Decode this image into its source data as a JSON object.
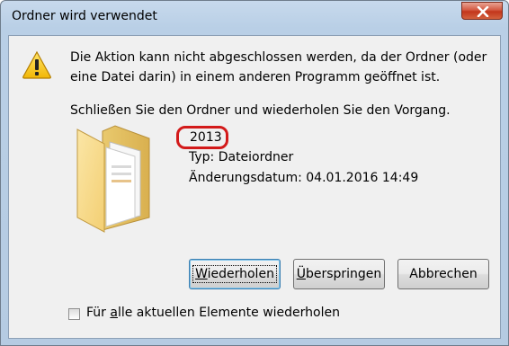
{
  "window": {
    "title": "Ordner wird verwendet",
    "close_icon": "close-icon"
  },
  "message": {
    "line1": "Die Aktion kann nicht abgeschlossen werden, da der Ordner (oder eine Datei darin) in einem anderen Programm geöffnet ist.",
    "line2": "Schließen Sie den Ordner und wiederholen Sie den Vorgang."
  },
  "item": {
    "name": "2013",
    "type": "Typ: Dateiordner",
    "modified": "Änderungsdatum: 04.01.2016 14:49",
    "icon": "folder-icon",
    "highlight_color": "#d31a1a"
  },
  "buttons": {
    "retry_pre": "",
    "retry_key": "W",
    "retry_post": "iederholen",
    "skip_pre": "",
    "skip_key": "Ü",
    "skip_post": "berspringen",
    "cancel": "Abbrechen"
  },
  "checkbox": {
    "label_pre": "Für ",
    "label_key": "a",
    "label_post": "lle aktuellen Elemente wiederholen",
    "checked": false
  }
}
